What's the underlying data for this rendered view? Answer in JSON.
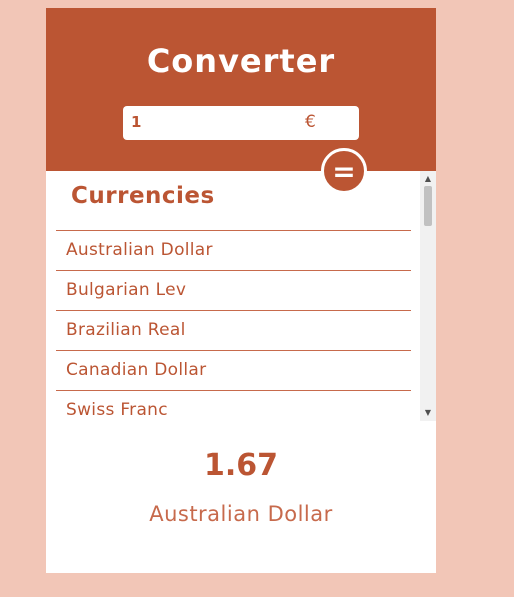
{
  "header": {
    "title": "Converter",
    "amount_value": "1",
    "currency_symbol": "€",
    "equals_label": "="
  },
  "list": {
    "heading": "Currencies",
    "items": [
      {
        "label": "Australian Dollar"
      },
      {
        "label": "Bulgarian Lev"
      },
      {
        "label": "Brazilian Real"
      },
      {
        "label": "Canadian Dollar"
      },
      {
        "label": "Swiss Franc"
      }
    ]
  },
  "scrollbar": {
    "up_arrow": "▲",
    "down_arrow": "▼"
  },
  "result": {
    "value": "1.67",
    "currency": "Australian Dollar"
  },
  "colors": {
    "page_background": "#f2c6b7",
    "accent": "#bb5533",
    "card_background": "#ffffff"
  }
}
